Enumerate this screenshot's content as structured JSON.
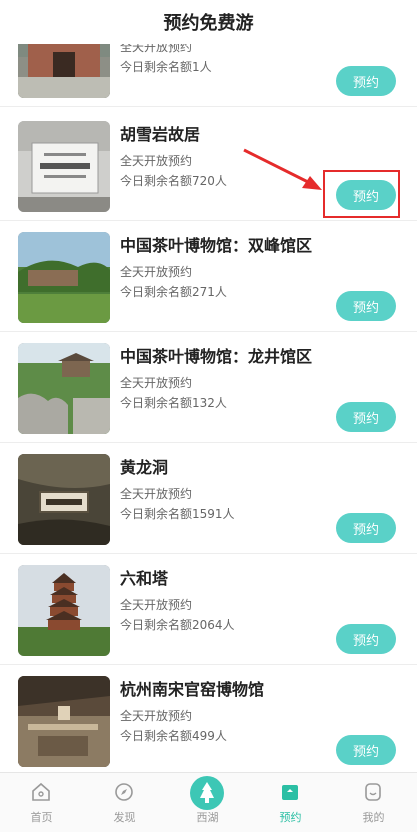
{
  "header": {
    "title": "预约免费游"
  },
  "items": [
    {
      "name": "",
      "info1": "全天开放预约",
      "info2": "今日剩余名额1人",
      "button": "预约"
    },
    {
      "name": "胡雪岩故居",
      "info1": "全天开放预约",
      "info2": "今日剩余名额720人",
      "button": "预约"
    },
    {
      "name": "中国茶叶博物馆：双峰馆区",
      "info1": "全天开放预约",
      "info2": "今日剩余名额271人",
      "button": "预约"
    },
    {
      "name": "中国茶叶博物馆：龙井馆区",
      "info1": "全天开放预约",
      "info2": "今日剩余名额132人",
      "button": "预约"
    },
    {
      "name": "黄龙洞",
      "info1": "全天开放预约",
      "info2": "今日剩余名额1591人",
      "button": "预约"
    },
    {
      "name": "六和塔",
      "info1": "全天开放预约",
      "info2": "今日剩余名额2064人",
      "button": "预约"
    },
    {
      "name": "杭州南宋官窑博物馆",
      "info1": "全天开放预约",
      "info2": "今日剩余名额499人",
      "button": "预约"
    }
  ],
  "tabbar": {
    "tabs": [
      {
        "label": "首页",
        "icon": "home-icon"
      },
      {
        "label": "发现",
        "icon": "compass-icon"
      },
      {
        "label": "西湖",
        "icon": "west-lake-icon"
      },
      {
        "label": "预约",
        "icon": "booking-icon"
      },
      {
        "label": "我的",
        "icon": "profile-icon"
      }
    ],
    "active_index": 3
  },
  "colors": {
    "accent": "#5ad1c8",
    "active_tab": "#2bbfa4",
    "highlight": "#e52b2b"
  }
}
